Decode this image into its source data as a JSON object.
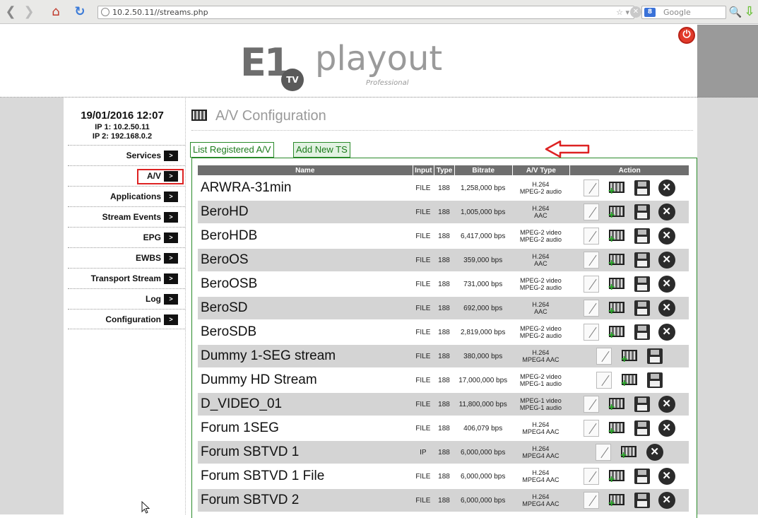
{
  "browser": {
    "url": "10.2.50.11//streams.php",
    "search_placeholder": "Google",
    "search_engine_badge": "8"
  },
  "logo": {
    "brand": "E1",
    "tv": "TV",
    "product": "playout",
    "edition": "Professional"
  },
  "sidebar": {
    "datetime": "19/01/2016 12:07",
    "ip1": "IP 1: 10.2.50.11",
    "ip2": "IP 2: 192.168.0.2",
    "go_label": ">",
    "items": [
      {
        "label": "Services"
      },
      {
        "label": "A/V"
      },
      {
        "label": "Applications"
      },
      {
        "label": "Stream Events"
      },
      {
        "label": "EPG"
      },
      {
        "label": "EWBS"
      },
      {
        "label": "Transport Stream"
      },
      {
        "label": "Log"
      },
      {
        "label": "Configuration"
      }
    ],
    "active_item": "A/V"
  },
  "main": {
    "title": "A/V Configuration",
    "tabs": [
      {
        "label": "List Registered A/V"
      },
      {
        "label": "Add New TS"
      }
    ],
    "table": {
      "headers": [
        "Name",
        "Input",
        "Type",
        "Bitrate",
        "A/V Type",
        "Action"
      ],
      "rows": [
        {
          "name": "ARWRA-31min",
          "input": "FILE",
          "type": "188",
          "bitrate": "1,258,000 bps",
          "av1": "H.264",
          "av2": "MPEG-2 audio",
          "actions": [
            "edit",
            "play",
            "save",
            "delete"
          ]
        },
        {
          "name": "BeroHD",
          "input": "FILE",
          "type": "188",
          "bitrate": "1,005,000 bps",
          "av1": "H.264",
          "av2": "AAC",
          "actions": [
            "edit",
            "play",
            "save",
            "delete"
          ]
        },
        {
          "name": "BeroHDB",
          "input": "FILE",
          "type": "188",
          "bitrate": "6,417,000 bps",
          "av1": "MPEG-2 video",
          "av2": "MPEG-2 audio",
          "actions": [
            "edit",
            "play",
            "save",
            "delete"
          ]
        },
        {
          "name": "BeroOS",
          "input": "FILE",
          "type": "188",
          "bitrate": "359,000 bps",
          "av1": "H.264",
          "av2": "AAC",
          "actions": [
            "edit",
            "play",
            "save",
            "delete"
          ]
        },
        {
          "name": "BeroOSB",
          "input": "FILE",
          "type": "188",
          "bitrate": "731,000 bps",
          "av1": "MPEG-2 video",
          "av2": "MPEG-2 audio",
          "actions": [
            "edit",
            "play",
            "save",
            "delete"
          ]
        },
        {
          "name": "BeroSD",
          "input": "FILE",
          "type": "188",
          "bitrate": "692,000 bps",
          "av1": "H.264",
          "av2": "AAC",
          "actions": [
            "edit",
            "play",
            "save",
            "delete"
          ]
        },
        {
          "name": "BeroSDB",
          "input": "FILE",
          "type": "188",
          "bitrate": "2,819,000 bps",
          "av1": "MPEG-2 video",
          "av2": "MPEG-2 audio",
          "actions": [
            "edit",
            "play",
            "save",
            "delete"
          ]
        },
        {
          "name": "Dummy 1-SEG stream",
          "input": "FILE",
          "type": "188",
          "bitrate": "380,000 bps",
          "av1": "H.264",
          "av2": "MPEG4 AAC",
          "actions": [
            "edit",
            "play",
            "save"
          ]
        },
        {
          "name": "Dummy HD Stream",
          "input": "FILE",
          "type": "188",
          "bitrate": "17,000,000 bps",
          "av1": "MPEG-2 video",
          "av2": "MPEG-1 audio",
          "actions": [
            "edit",
            "play",
            "save"
          ]
        },
        {
          "name": "D_VIDEO_01",
          "input": "FILE",
          "type": "188",
          "bitrate": "11,800,000 bps",
          "av1": "MPEG-1 video",
          "av2": "MPEG-1 audio",
          "actions": [
            "edit",
            "play",
            "save",
            "delete"
          ]
        },
        {
          "name": "Forum 1SEG",
          "input": "FILE",
          "type": "188",
          "bitrate": "406,079 bps",
          "av1": "H.264",
          "av2": "MPEG4 AAC",
          "actions": [
            "edit",
            "play",
            "save",
            "delete"
          ]
        },
        {
          "name": "Forum SBTVD 1",
          "input": "IP",
          "type": "188",
          "bitrate": "6,000,000 bps",
          "av1": "H.264",
          "av2": "MPEG4 AAC",
          "actions": [
            "edit",
            "play",
            "delete"
          ]
        },
        {
          "name": "Forum SBTVD 1 File",
          "input": "FILE",
          "type": "188",
          "bitrate": "6,000,000 bps",
          "av1": "H.264",
          "av2": "MPEG4 AAC",
          "actions": [
            "edit",
            "play",
            "save",
            "delete"
          ]
        },
        {
          "name": "Forum SBTVD 2",
          "input": "FILE",
          "type": "188",
          "bitrate": "6,000,000 bps",
          "av1": "H.264",
          "av2": "MPEG4 AAC",
          "actions": [
            "edit",
            "play",
            "save",
            "delete"
          ]
        }
      ]
    }
  },
  "colors": {
    "accent_green": "#2a8a2a",
    "highlight_red": "#dd2222",
    "table_header": "#6e6e6e",
    "alt_row": "#d4d4d4"
  }
}
